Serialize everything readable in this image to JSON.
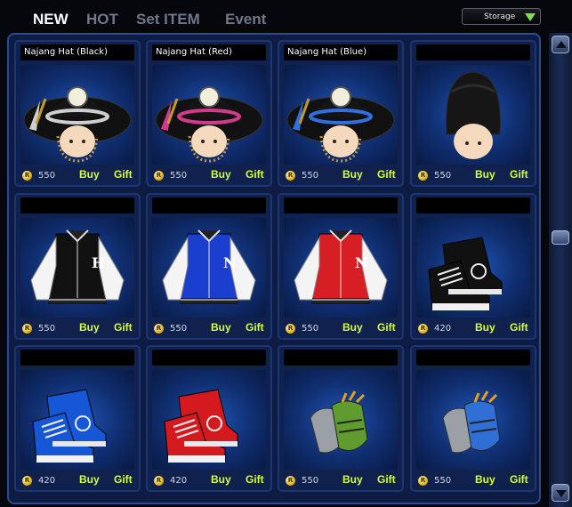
{
  "tabs": [
    {
      "label": "NEW",
      "active": true
    },
    {
      "label": "HOT",
      "active": false
    },
    {
      "label": "Set ITEM",
      "active": false
    },
    {
      "label": "Event",
      "active": false
    }
  ],
  "storage_label": "Storage",
  "coin_letter": "R",
  "buy_label": "Buy",
  "gift_label": "Gift",
  "items": [
    {
      "name": "Najang Hat (Black)",
      "price": "550",
      "icon": "najang-hat-black-icon",
      "accent": "#cfcfcf"
    },
    {
      "name": "Najang Hat (Red)",
      "price": "550",
      "icon": "najang-hat-red-icon",
      "accent": "#d23b8c"
    },
    {
      "name": "Najang Hat (Blue)",
      "price": "550",
      "icon": "najang-hat-blue-icon",
      "accent": "#2f6fe0"
    },
    {
      "name": "",
      "price": "550",
      "icon": "black-bearskin-hat-icon",
      "accent": "#111111"
    },
    {
      "name": "",
      "price": "550",
      "icon": "black-varsity-jacket-icon",
      "accent": "#111111"
    },
    {
      "name": "",
      "price": "550",
      "icon": "blue-varsity-jacket-icon",
      "accent": "#1a3fcf"
    },
    {
      "name": "",
      "price": "550",
      "icon": "red-varsity-jacket-icon",
      "accent": "#d81e25"
    },
    {
      "name": "",
      "price": "420",
      "icon": "black-sneakers-icon",
      "accent": "#111111"
    },
    {
      "name": "",
      "price": "420",
      "icon": "blue-sneakers-icon",
      "accent": "#1557d6"
    },
    {
      "name": "",
      "price": "420",
      "icon": "red-sneakers-icon",
      "accent": "#d51a1f"
    },
    {
      "name": "",
      "price": "550",
      "icon": "green-gloves-icon",
      "accent": "#5f9b2e"
    },
    {
      "name": "",
      "price": "550",
      "icon": "blue-gloves-icon",
      "accent": "#2f6fd6"
    }
  ]
}
